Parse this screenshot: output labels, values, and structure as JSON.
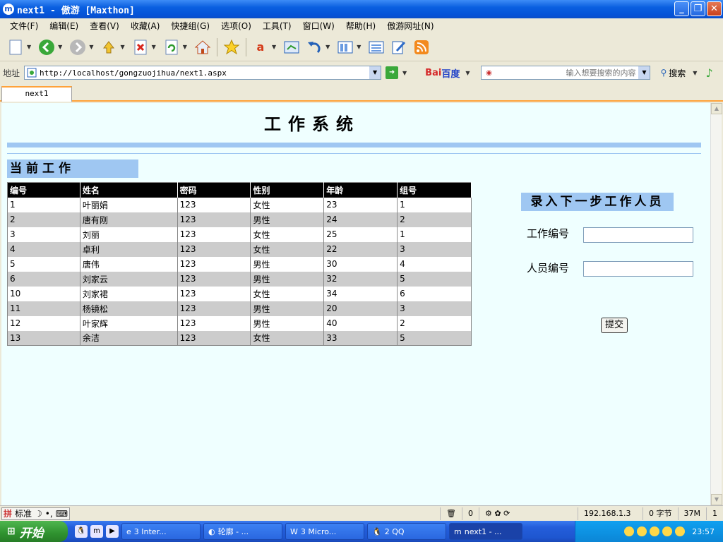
{
  "window": {
    "title": "next1 - 傲游 [Maxthon]",
    "app_icon": "m",
    "minimize": "_",
    "restore": "❐",
    "close": "✕"
  },
  "menu": [
    "文件(F)",
    "编辑(E)",
    "查看(V)",
    "收藏(A)",
    "快捷组(G)",
    "选项(O)",
    "工具(T)",
    "窗口(W)",
    "帮助(H)",
    "傲游网址(N)"
  ],
  "toolbar": {
    "icons": [
      "new-page-icon",
      "back-icon",
      "forward-icon",
      "up-icon",
      "stop-icon",
      "refresh-icon",
      "home-icon",
      "favorites-star-icon",
      "translate-icon",
      "screen-icon",
      "undo-icon",
      "columns-icon",
      "list-icon",
      "edit-icon",
      "rss-icon"
    ]
  },
  "address": {
    "label": "地址",
    "url": "http://localhost/gongzuojihua/next1.aspx",
    "baidu_left": "Bai",
    "baidu_right": "百度",
    "search_placeholder": "输入想要搜索的内容",
    "search_label": "搜索"
  },
  "tabs": [
    "next1"
  ],
  "page": {
    "title": "工作系统",
    "section_title": "当前工作",
    "table": {
      "headers": [
        "编号",
        "姓名",
        "密码",
        "性别",
        "年龄",
        "组号"
      ],
      "rows": [
        [
          "1",
          "叶丽娟",
          "123",
          "女性",
          "23",
          "1"
        ],
        [
          "2",
          "唐有刚",
          "123",
          "男性",
          "24",
          "2"
        ],
        [
          "3",
          "刘丽",
          "123",
          "女性",
          "25",
          "1"
        ],
        [
          "4",
          "卓利",
          "123",
          "女性",
          "22",
          "3"
        ],
        [
          "5",
          "唐伟",
          "123",
          "男性",
          "30",
          "4"
        ],
        [
          "6",
          "刘家云",
          "123",
          "男性",
          "32",
          "5"
        ],
        [
          "10",
          "刘家裙",
          "123",
          "女性",
          "34",
          "6"
        ],
        [
          "11",
          "杨镜松",
          "123",
          "男性",
          "20",
          "3"
        ],
        [
          "12",
          "叶家辉",
          "123",
          "男性",
          "40",
          "2"
        ],
        [
          "13",
          "余洁",
          "123",
          "女性",
          "33",
          "5"
        ]
      ]
    },
    "form": {
      "title": "录入下一步工作人员",
      "work_id_label": "工作编号",
      "work_id_value": "",
      "person_id_label": "人员编号",
      "person_id_value": "",
      "submit_label": "提交"
    }
  },
  "statusbar": {
    "ime_mode": "标准",
    "popup_count": "0",
    "ip": "192.168.1.3",
    "bytes": "0 字节",
    "memory": "37M",
    "windows": "1"
  },
  "taskbar": {
    "start": "开始",
    "tasks": [
      "3 Inter...",
      "轮廓 - ...",
      "3 Micro...",
      "2 QQ",
      "next1 - ..."
    ],
    "clock": "23:57"
  }
}
